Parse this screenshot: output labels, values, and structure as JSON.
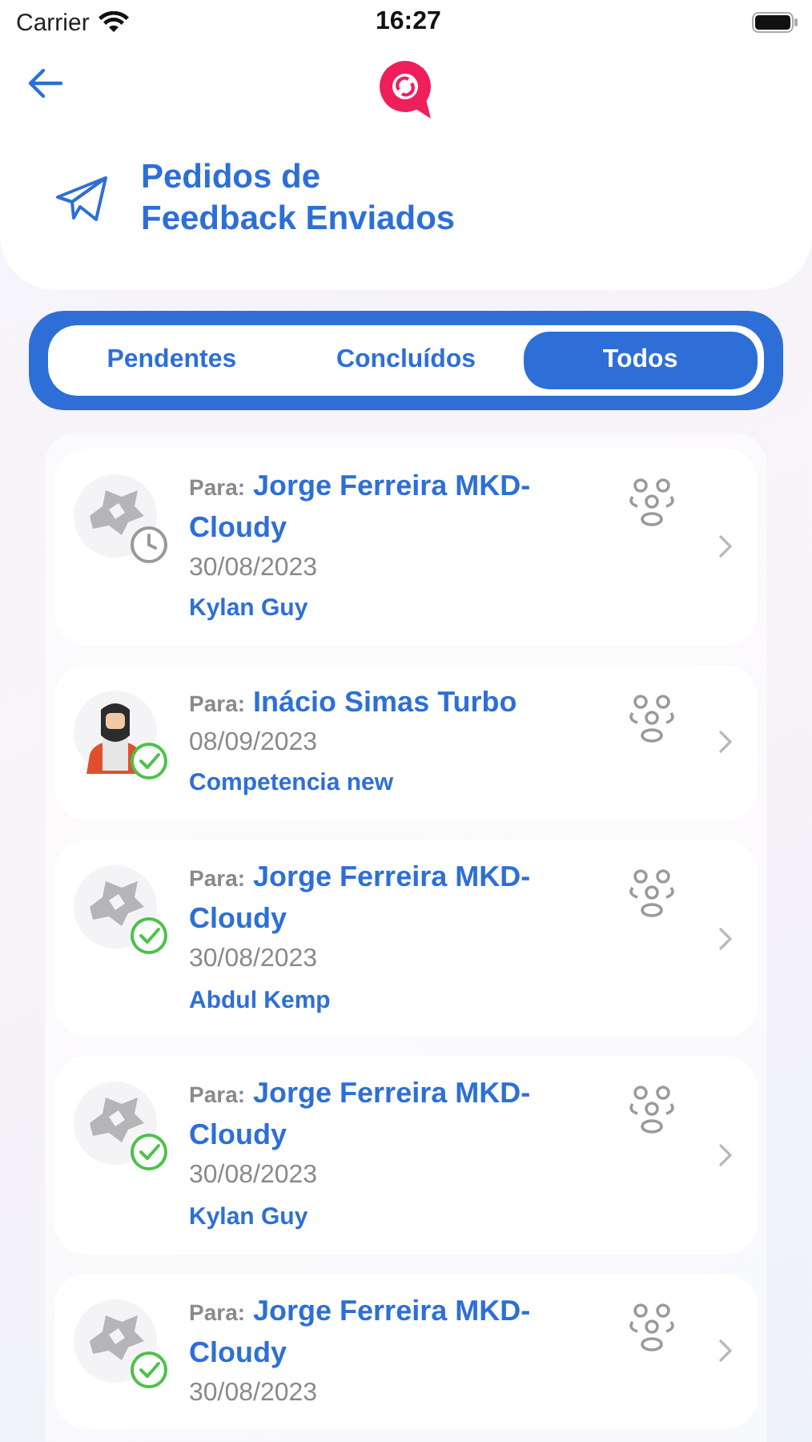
{
  "status_bar": {
    "carrier": "Carrier",
    "time": "16:27"
  },
  "title": "Pedidos de Feedback Enviados",
  "tabs": [
    {
      "label": "Pendentes",
      "selected": false
    },
    {
      "label": "Concluídos",
      "selected": false
    },
    {
      "label": "Todos",
      "selected": true
    }
  ],
  "requests": [
    {
      "kind": "logo",
      "completed": false,
      "prefix": "Para:",
      "recipient": "Jorge Ferreira MKD-Cloudy",
      "date": "30/08/2023",
      "subject": "Kylan Guy"
    },
    {
      "kind": "person",
      "completed": true,
      "prefix": "Para:",
      "recipient": "Inácio Simas Turbo",
      "date": "08/09/2023",
      "subject": "Competencia new"
    },
    {
      "kind": "logo",
      "completed": true,
      "prefix": "Para:",
      "recipient": "Jorge Ferreira MKD-Cloudy",
      "date": "30/08/2023",
      "subject": "Abdul Kemp"
    },
    {
      "kind": "logo",
      "completed": true,
      "prefix": "Para:",
      "recipient": "Jorge Ferreira MKD-Cloudy",
      "date": "30/08/2023",
      "subject": "Kylan Guy"
    },
    {
      "kind": "logo",
      "completed": true,
      "prefix": "Para:",
      "recipient": "Jorge Ferreira MKD-Cloudy",
      "date": "30/08/2023"
    }
  ]
}
